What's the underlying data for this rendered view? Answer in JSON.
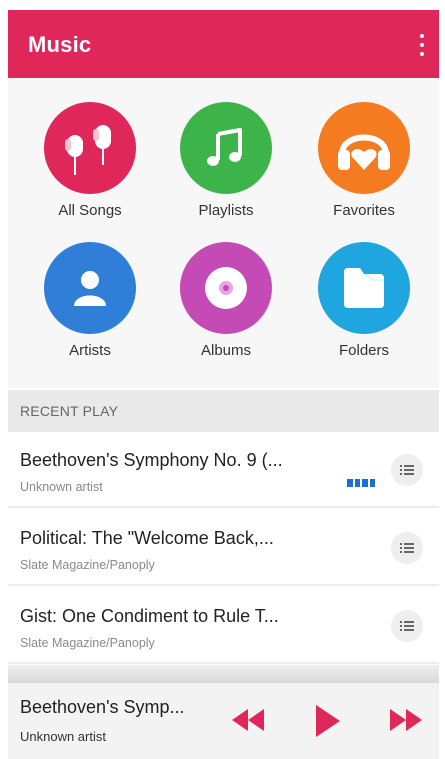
{
  "appbar": {
    "title": "Music"
  },
  "categories": [
    {
      "label": "All Songs",
      "color": "#e0275a",
      "icon": "earphones-icon"
    },
    {
      "label": "Playlists",
      "color": "#3cb44a",
      "icon": "music-note-icon"
    },
    {
      "label": "Favorites",
      "color": "#f47b20",
      "icon": "headphones-heart-icon"
    },
    {
      "label": "Artists",
      "color": "#2f7fd8",
      "icon": "person-icon"
    },
    {
      "label": "Albums",
      "color": "#c44bb6",
      "icon": "disc-icon"
    },
    {
      "label": "Folders",
      "color": "#1fa6e0",
      "icon": "folder-icon"
    }
  ],
  "recent": {
    "header": "RECENT PLAY",
    "items": [
      {
        "title": "Beethoven's Symphony No. 9 (...",
        "subtitle": "Unknown artist",
        "playing": true
      },
      {
        "title": "Political: The \"Welcome Back,...",
        "subtitle": "Slate Magazine/Panoply",
        "playing": false
      },
      {
        "title": "Gist: One Condiment to Rule T...",
        "subtitle": "Slate Magazine/Panoply",
        "playing": false
      }
    ]
  },
  "player": {
    "title": "Beethoven's Symp...",
    "artist": "Unknown artist",
    "accent": "#e0275a"
  }
}
